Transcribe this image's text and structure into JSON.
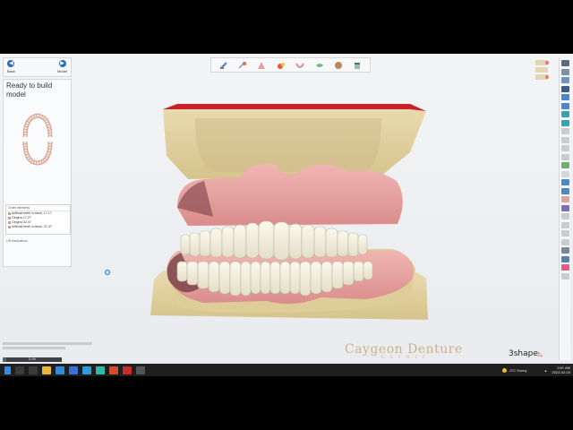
{
  "nav": {
    "back_label": "Back",
    "next_label": "Model"
  },
  "panel": {
    "title": "Ready to build model",
    "order_header": "Order elements",
    "order_items": [
      "Artificial teeth in block, 17-17",
      "Gingiva 17-27",
      "Gingiva 32-47",
      "Artificial teeth in block, 37-47"
    ],
    "lift_label": "Lift restorations"
  },
  "toolbar": {
    "icons": [
      "scanner-icon",
      "tools-icon",
      "gingiva-icon",
      "color-icon",
      "lower-arch-icon",
      "view-icon",
      "tooth-icon",
      "cup-icon"
    ]
  },
  "progress": {
    "label": "5.4%",
    "fraction": 0.054
  },
  "logo": {
    "main": "Caygeon Denture",
    "sub": "CLINIC"
  },
  "brand": {
    "name": "3shape"
  },
  "taskbar": {
    "weather": "-3°C  Sunny",
    "time": "9:57 AM",
    "date": "2022-02-03"
  },
  "colors": {
    "gum": "#e8a5a5",
    "tooth": "#f2efdf",
    "base": "#e3d2a0",
    "accent": "#2d6db5"
  }
}
